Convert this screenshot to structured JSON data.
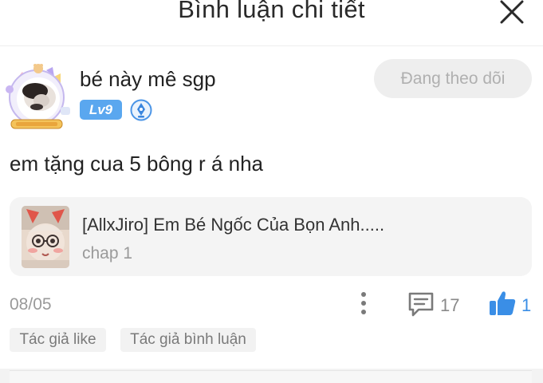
{
  "header": {
    "title": "Bình luận chi tiết",
    "close_icon": "close-icon"
  },
  "comment": {
    "user": {
      "name": "bé này mê sgp",
      "level": "Lv9",
      "avatar_icon": "avatar",
      "verified_icon": "pen-badge-icon"
    },
    "follow_button": "Đang theo dõi",
    "text": "em tặng cua 5 bông r á nha",
    "story": {
      "title": "[AllxJiro] Em Bé Ngốc Của Bọn Anh.....",
      "chapter": "chap 1"
    },
    "date": "08/05",
    "reply_count": "17",
    "like_count": "1",
    "tags": [
      "Tác giả like",
      "Tác giả bình luận"
    ]
  },
  "colors": {
    "accent": "#3a8ee6",
    "level_badge": "#5aa7ef",
    "muted_text": "#9a9a9a",
    "card_bg": "#f4f4f4"
  }
}
